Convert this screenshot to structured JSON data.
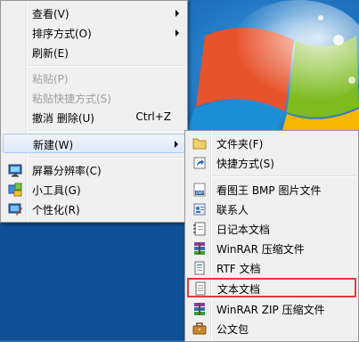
{
  "context_menu": {
    "view": "查看(V)",
    "sort_by": "排序方式(O)",
    "refresh": "刷新(E)",
    "paste": "粘贴(P)",
    "paste_shortcut": "粘贴快捷方式(S)",
    "undo_delete": "撤消 删除(U)",
    "undo_shortcut_key": "Ctrl+Z",
    "new": "新建(W)",
    "screen_resolution": "屏幕分辨率(C)",
    "gadgets": "小工具(G)",
    "personalize": "个性化(R)"
  },
  "new_submenu": {
    "folder": "文件夹(F)",
    "shortcut": "快捷方式(S)",
    "bmp_image": "看图王 BMP 图片文件",
    "contact": "联系人",
    "journal_document": "日记本文档",
    "winrar_archive": "WinRAR 压缩文件",
    "rtf_document": "RTF 文档",
    "text_document": "文本文档",
    "winrar_zip_archive": "WinRAR ZIP 压缩文件",
    "briefcase": "公文包"
  },
  "colors": {
    "highlight_outline": "#e03a3a",
    "menu_background": "#f0f0f0",
    "disabled_text": "#9f9f9f"
  }
}
